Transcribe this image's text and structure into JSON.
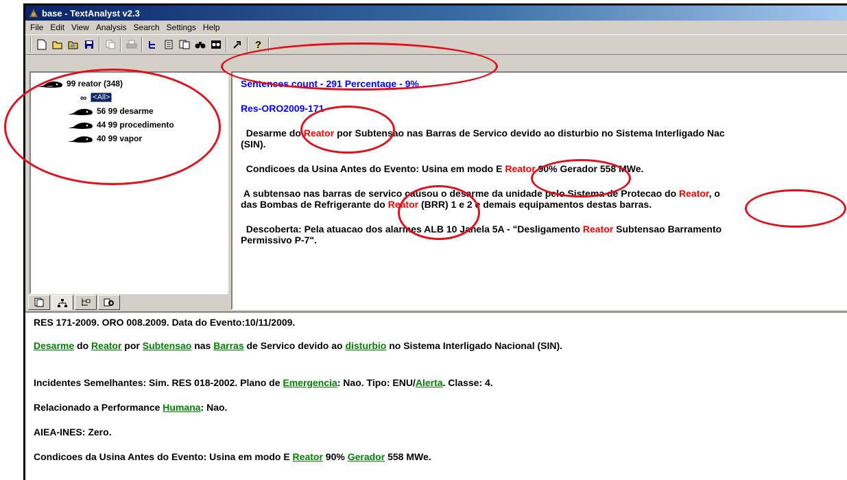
{
  "window": {
    "title": "base - TextAnalyst v2.3"
  },
  "menu": [
    "File",
    "Edit",
    "View",
    "Analysis",
    "Search",
    "Settings",
    "Help"
  ],
  "toolbar": {
    "icons": [
      "new-file-icon",
      "open-folder-icon",
      "open-project-icon",
      "save-icon",
      "copy-icon",
      "print-icon",
      "tree-icon",
      "document-icon",
      "documents-icon",
      "binoculars-icon",
      "find-next-icon",
      "cursor-icon",
      "help-icon"
    ]
  },
  "tree": {
    "root": "99 reator (348)",
    "all_label": "<All>",
    "children": [
      "56 99 desarme",
      "44 99 procedimento",
      "40 99 vapor"
    ]
  },
  "tabs": [
    "pages-tab",
    "network-tab",
    "tree-tab",
    "search-tab"
  ],
  "results": {
    "summary": "Sentences count - 291  Percentage - 9%",
    "doc_id": "Res-ORO2009-171",
    "s1": {
      "a": "Desarme do ",
      "hl": "Reator",
      "b": " por Subtensao nas Barras de Servico devido ao disturbio no Sistema Interligado Nac",
      "c": "(SIN)."
    },
    "s2": {
      "a": "Condicoes da Usina Antes do Evento: Usina em modo E ",
      "hl": "Reator",
      "b": " 90% Gerador 558 MWe."
    },
    "s3": {
      "a": "A subtensao nas barras de servico causou o desarme da unidade pelo Sistema de Protecao do ",
      "hl": "Reator",
      "b": ", o",
      "c": "das Bombas de Refrigerante do ",
      "hl2": "Reator",
      "d": " (BRR) 1 e 2 e demais equipamentos destas barras."
    },
    "s4": {
      "a": "Descoberta: Pela atuacao dos alarmes ALB 10 Janela 5A - \"Desligamento ",
      "hl": "Reator",
      "b": " Subtensao Barramento",
      "c": "Permissivo P-7\"."
    }
  },
  "document": {
    "line1": "RES 171-2009. ORO 008.2009. Data do Evento:10/11/2009.",
    "line2": {
      "w1": "Desarme",
      "t1": " do ",
      "w2": "Reator",
      "t2": " por ",
      "w3": "Subtensao",
      "t3": " nas ",
      "w4": "Barras",
      "t4": " de Servico devido ao ",
      "w5": "disturbio",
      "t5": " no Sistema Interligado Nacional (SIN)."
    },
    "line3": {
      "a": "Incidentes Semelhantes: Sim. RES 018-2002. Plano de ",
      "w1": "Emergencia",
      "b": ": Nao. Tipo: ENU/",
      "w2": "Alerta",
      "c": ". Classe: 4."
    },
    "line4": {
      "a": "Relacionado a Performance ",
      "w1": "Humana",
      "b": ": Nao."
    },
    "line5": "AIEA-INES: Zero.",
    "line6": {
      "a": "Condicoes da Usina Antes do Evento: Usina em modo E ",
      "w1": "Reator",
      "b": " 90% ",
      "w2": "Gerador",
      "c": " 558 MWe."
    }
  },
  "colors": {
    "annotation": "#e0101c",
    "highlight": "#ff0000",
    "link": "#008000",
    "summary": "#0000ff"
  }
}
